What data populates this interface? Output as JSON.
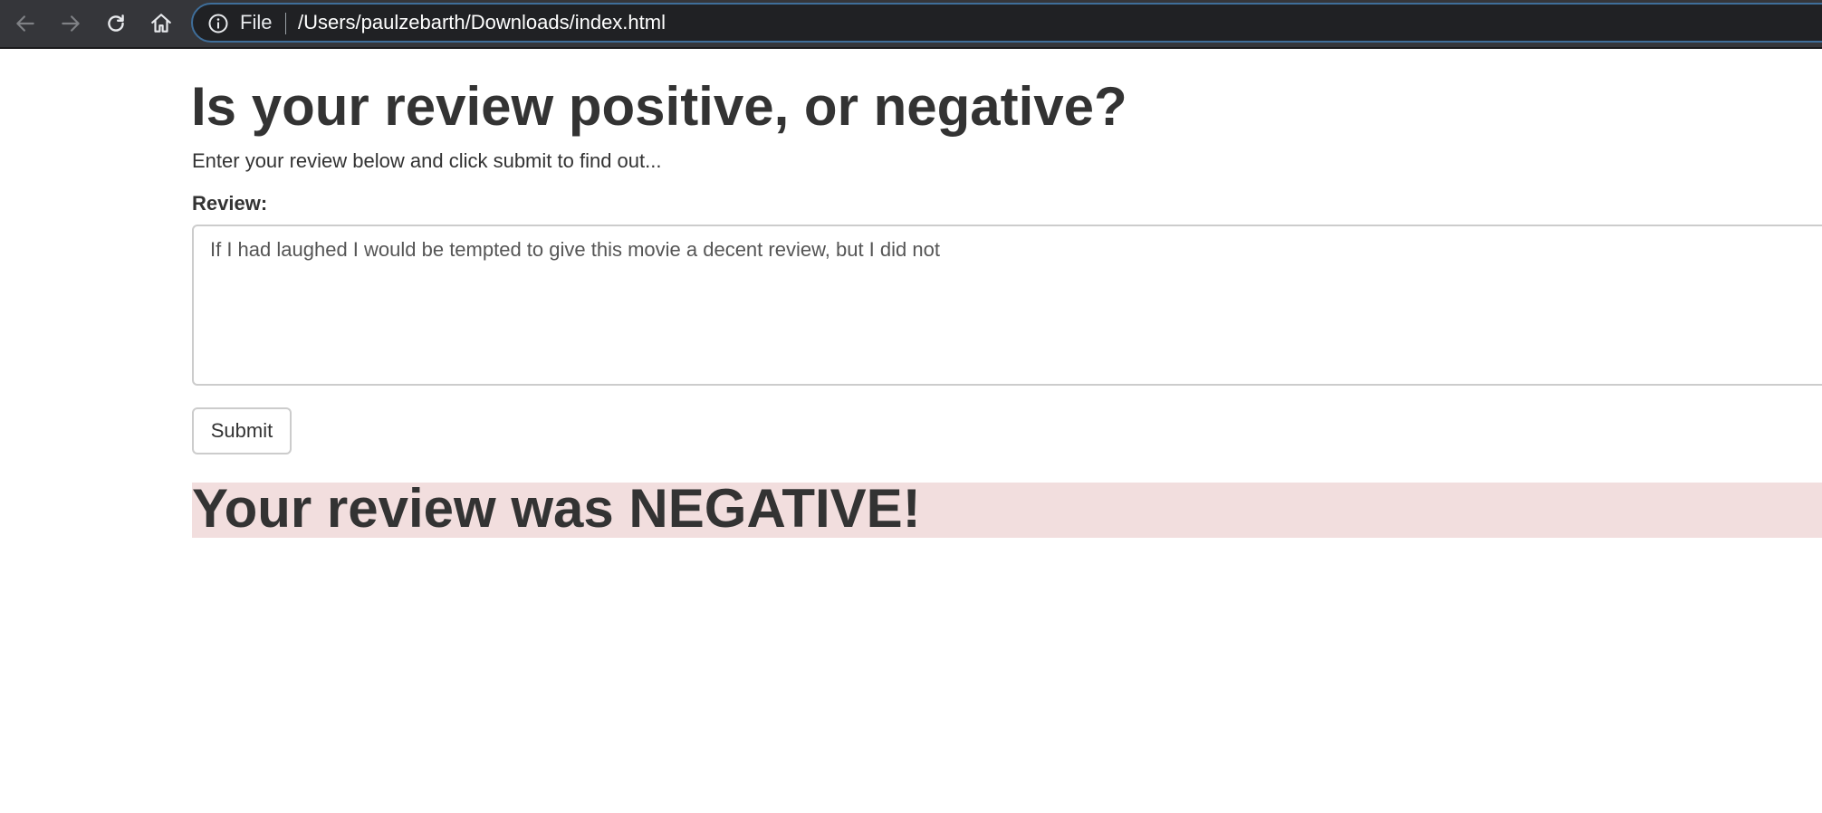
{
  "browser": {
    "address_bar": {
      "scheme_label": "File",
      "url": "/Users/paulzebarth/Downloads/index.html"
    },
    "icons": {
      "back": "arrow-left-icon",
      "forward": "arrow-right-icon",
      "reload": "reload-icon",
      "home": "home-icon",
      "info": "info-circle-icon"
    },
    "colors": {
      "toolbar_bg": "#35363a",
      "omnibox_bg": "#202124",
      "omnibox_focus_border": "#3f6e9a"
    }
  },
  "page": {
    "title": "Is your review positive, or negative?",
    "intro": "Enter your review below and click submit to find out...",
    "form": {
      "review_label": "Review:",
      "review_value": "If I had laughed I would be tempted to give this movie a decent review, but I did not",
      "submit_label": "Submit"
    },
    "result": {
      "text": "Your review was NEGATIVE!",
      "sentiment": "negative",
      "background_color": "#f2dede"
    }
  }
}
